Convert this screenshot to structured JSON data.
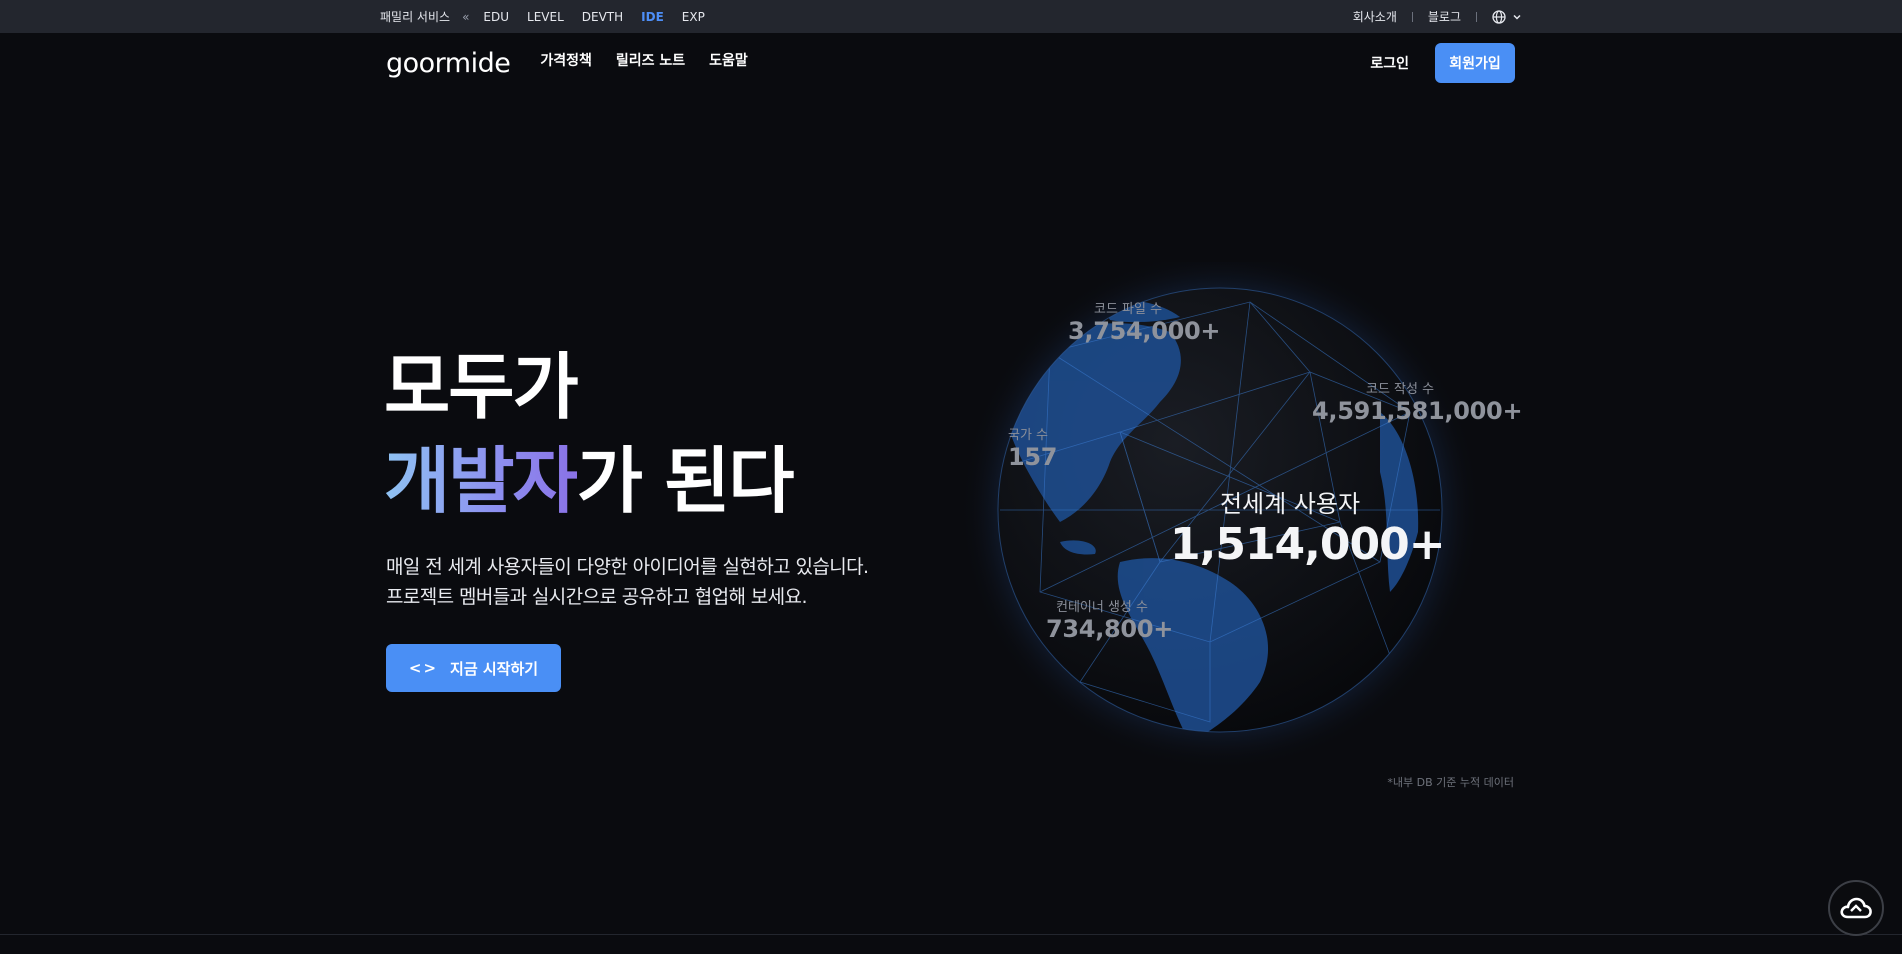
{
  "family_bar": {
    "label": "패밀리 서비스",
    "chevron": "«",
    "services": [
      "EDU",
      "LEVEL",
      "DEVTH",
      "IDE",
      "EXP"
    ],
    "active_service": "IDE",
    "links": [
      "회사소개",
      "블로그"
    ],
    "language_icon": "globe-icon"
  },
  "header": {
    "logo": "goormide",
    "nav": [
      "가격정책",
      "릴리즈 노트",
      "도움말"
    ],
    "login": "로그인",
    "signup": "회원가입"
  },
  "hero": {
    "title_line1": "모두가",
    "title_line2_highlight": "개발자",
    "title_line2_rest": "가 된다",
    "desc_line1": "매일 전 세계 사용자들이 다양한 아이디어를 실현하고 있습니다.",
    "desc_line2": "프로젝트 멤버들과 실시간으로 공유하고 협업해 보세요.",
    "cta_icon": "<>",
    "cta": "지금 시작하기"
  },
  "stats": {
    "code_files": {
      "label": "코드 파일 수",
      "value": "3,754,000+"
    },
    "code_writes": {
      "label": "코드 작성 수",
      "value": "4,591,581,000+"
    },
    "countries": {
      "label": "국가 수",
      "value": "157"
    },
    "users": {
      "label": "전세계 사용자",
      "value": "1,514,000+"
    },
    "containers": {
      "label": "컨테이너 생성 수",
      "value": "734,800+"
    }
  },
  "footnote": "*내부 DB 기준 누적 데이터",
  "colors": {
    "accent": "#4a8ff5",
    "background": "#0a0b0f",
    "topbar": "#23262e"
  }
}
